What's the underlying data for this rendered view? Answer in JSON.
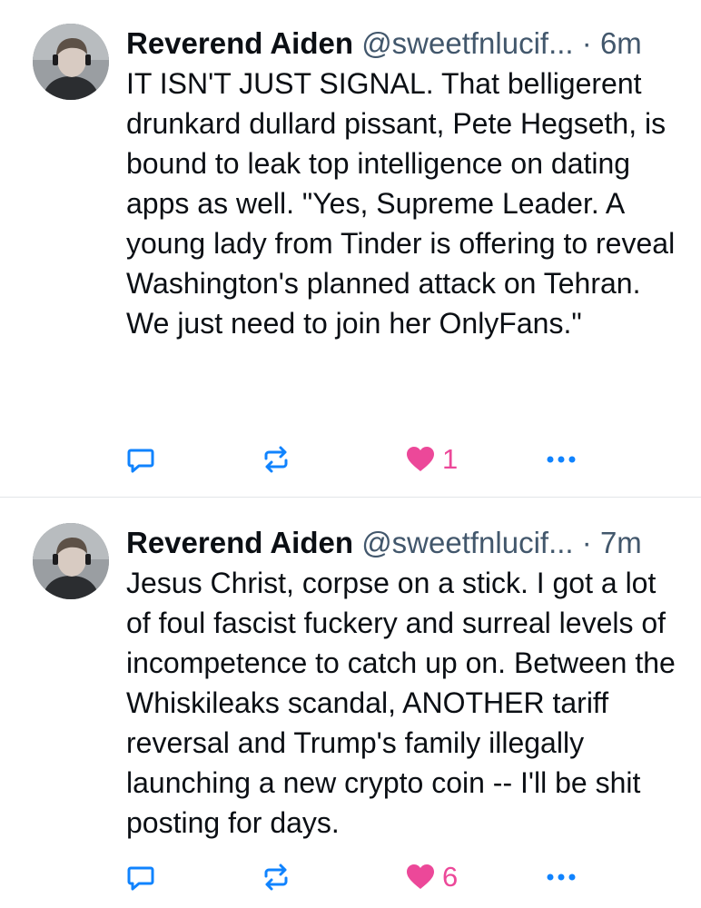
{
  "accent_like_color": "#ec4899",
  "icon_color": "#1083fe",
  "posts": [
    {
      "avatar": {
        "icon": "avatar-photo"
      },
      "author_name": "Reverend Aiden",
      "author_handle": "@sweetfnlucif...",
      "separator": "·",
      "time": "6m",
      "text": "IT ISN'T JUST SIGNAL. That belligerent drunkard dullard pissant, Pete Hegseth, is bound to leak top intelligence on dating apps as well. \"Yes, Supreme Leader. A young lady from Tinder is offering to reveal Washington's planned attack on Tehran. We just need to join her OnlyFans.\"",
      "actions": {
        "reply_icon": "reply-icon",
        "repost_icon": "repost-icon",
        "like_icon": "heart-filled-icon",
        "like_count": "1",
        "more_icon": "more-dots-icon"
      }
    },
    {
      "avatar": {
        "icon": "avatar-photo"
      },
      "author_name": "Reverend Aiden",
      "author_handle": "@sweetfnlucif...",
      "separator": "·",
      "time": "7m",
      "text": "Jesus Christ, corpse on a stick. I got a lot of foul fascist fuckery and surreal levels of incompetence to catch up on. Between the Whiskileaks scandal, ANOTHER tariff reversal and Trump's family illegally launching a new crypto coin -- I'll be shit posting for days.",
      "actions": {
        "reply_icon": "reply-icon",
        "repost_icon": "repost-icon",
        "like_icon": "heart-filled-icon",
        "like_count": "6",
        "more_icon": "more-dots-icon"
      }
    }
  ]
}
